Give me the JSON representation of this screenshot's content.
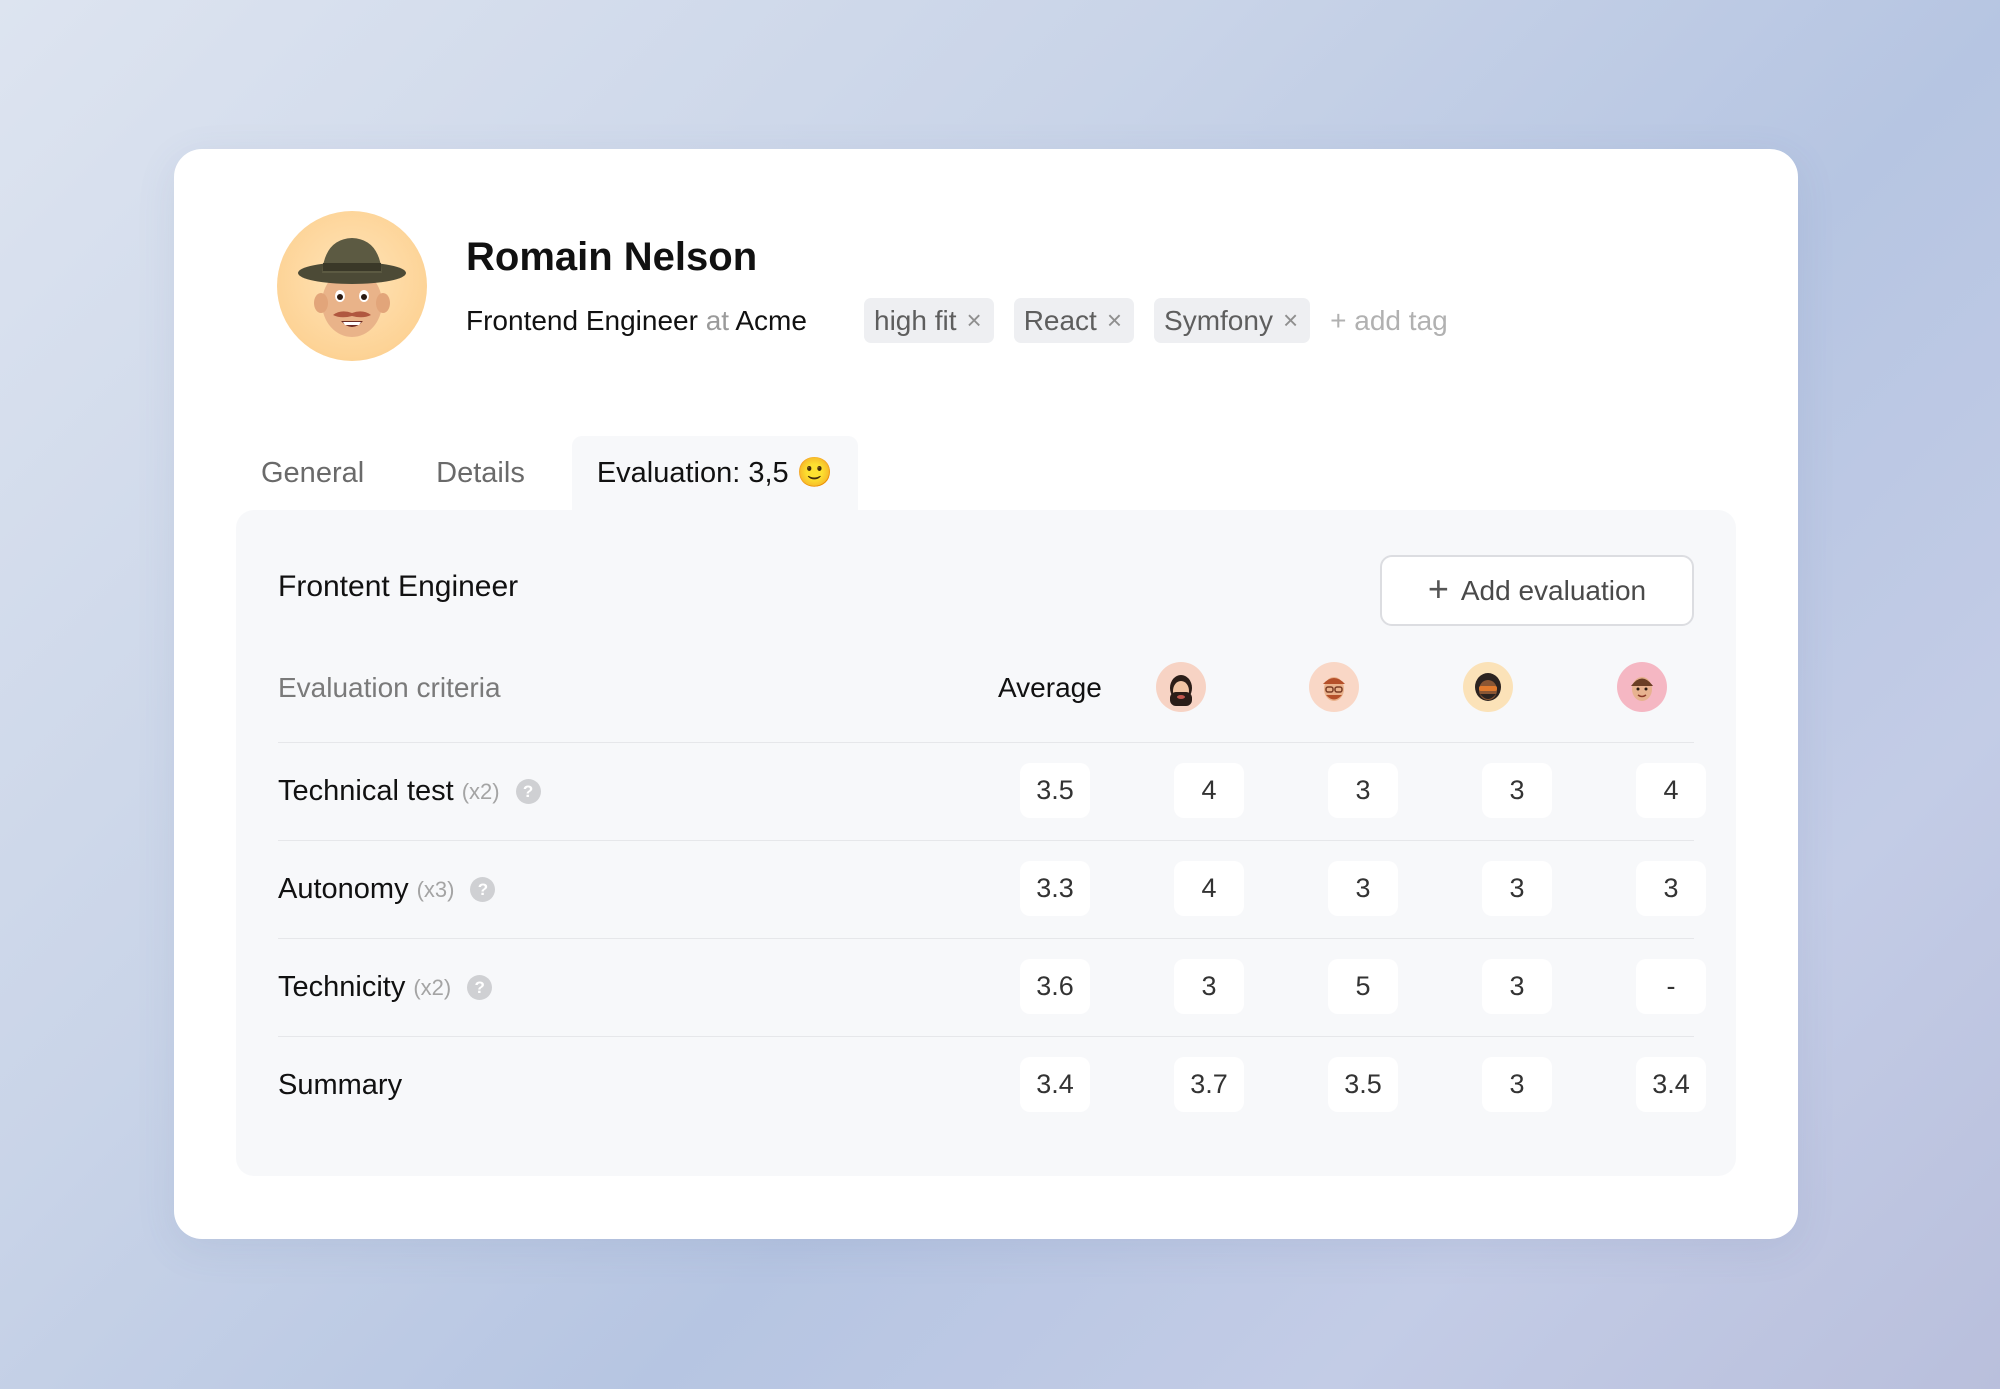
{
  "candidate": {
    "name": "Romain Nelson",
    "role": "Frontend Engineer",
    "at": "at",
    "company": "Acme"
  },
  "tags": [
    {
      "label": "high fit",
      "remove": "×"
    },
    {
      "label": "React",
      "remove": "×"
    },
    {
      "label": "Symfony",
      "remove": "×"
    }
  ],
  "add_tag": "+ add tag",
  "tabs": [
    {
      "label": "General",
      "active": false
    },
    {
      "label": "Details",
      "active": false
    },
    {
      "label": "Evaluation: 3,5 🙂",
      "active": true
    }
  ],
  "panel": {
    "title": "Frontent Engineer",
    "add_button_icon": "+",
    "add_button_label": "Add evaluation",
    "criteria_header": "Evaluation criteria",
    "average_header": "Average",
    "reviewers": [
      {
        "icon": "reviewer-avatar-1",
        "bg": "#f7d3c4"
      },
      {
        "icon": "reviewer-avatar-2",
        "bg": "#f9d7c6"
      },
      {
        "icon": "reviewer-avatar-3",
        "bg": "#fbe2b8"
      },
      {
        "icon": "reviewer-avatar-4",
        "bg": "#f5b7c3"
      }
    ],
    "rows": [
      {
        "label": "Technical test",
        "weight": "(x2)",
        "help": "?",
        "average": "3.5",
        "scores": [
          "4",
          "3",
          "3",
          "4"
        ]
      },
      {
        "label": "Autonomy",
        "weight": "(x3)",
        "help": "?",
        "average": "3.3",
        "scores": [
          "4",
          "3",
          "3",
          "3"
        ]
      },
      {
        "label": "Technicity",
        "weight": "(x2)",
        "help": "?",
        "average": "3.6",
        "scores": [
          "3",
          "5",
          "3",
          "-"
        ]
      },
      {
        "label": "Summary",
        "weight": "",
        "help": "",
        "average": "3.4",
        "scores": [
          "3.7",
          "3.5",
          "3",
          "3.4"
        ]
      }
    ]
  }
}
